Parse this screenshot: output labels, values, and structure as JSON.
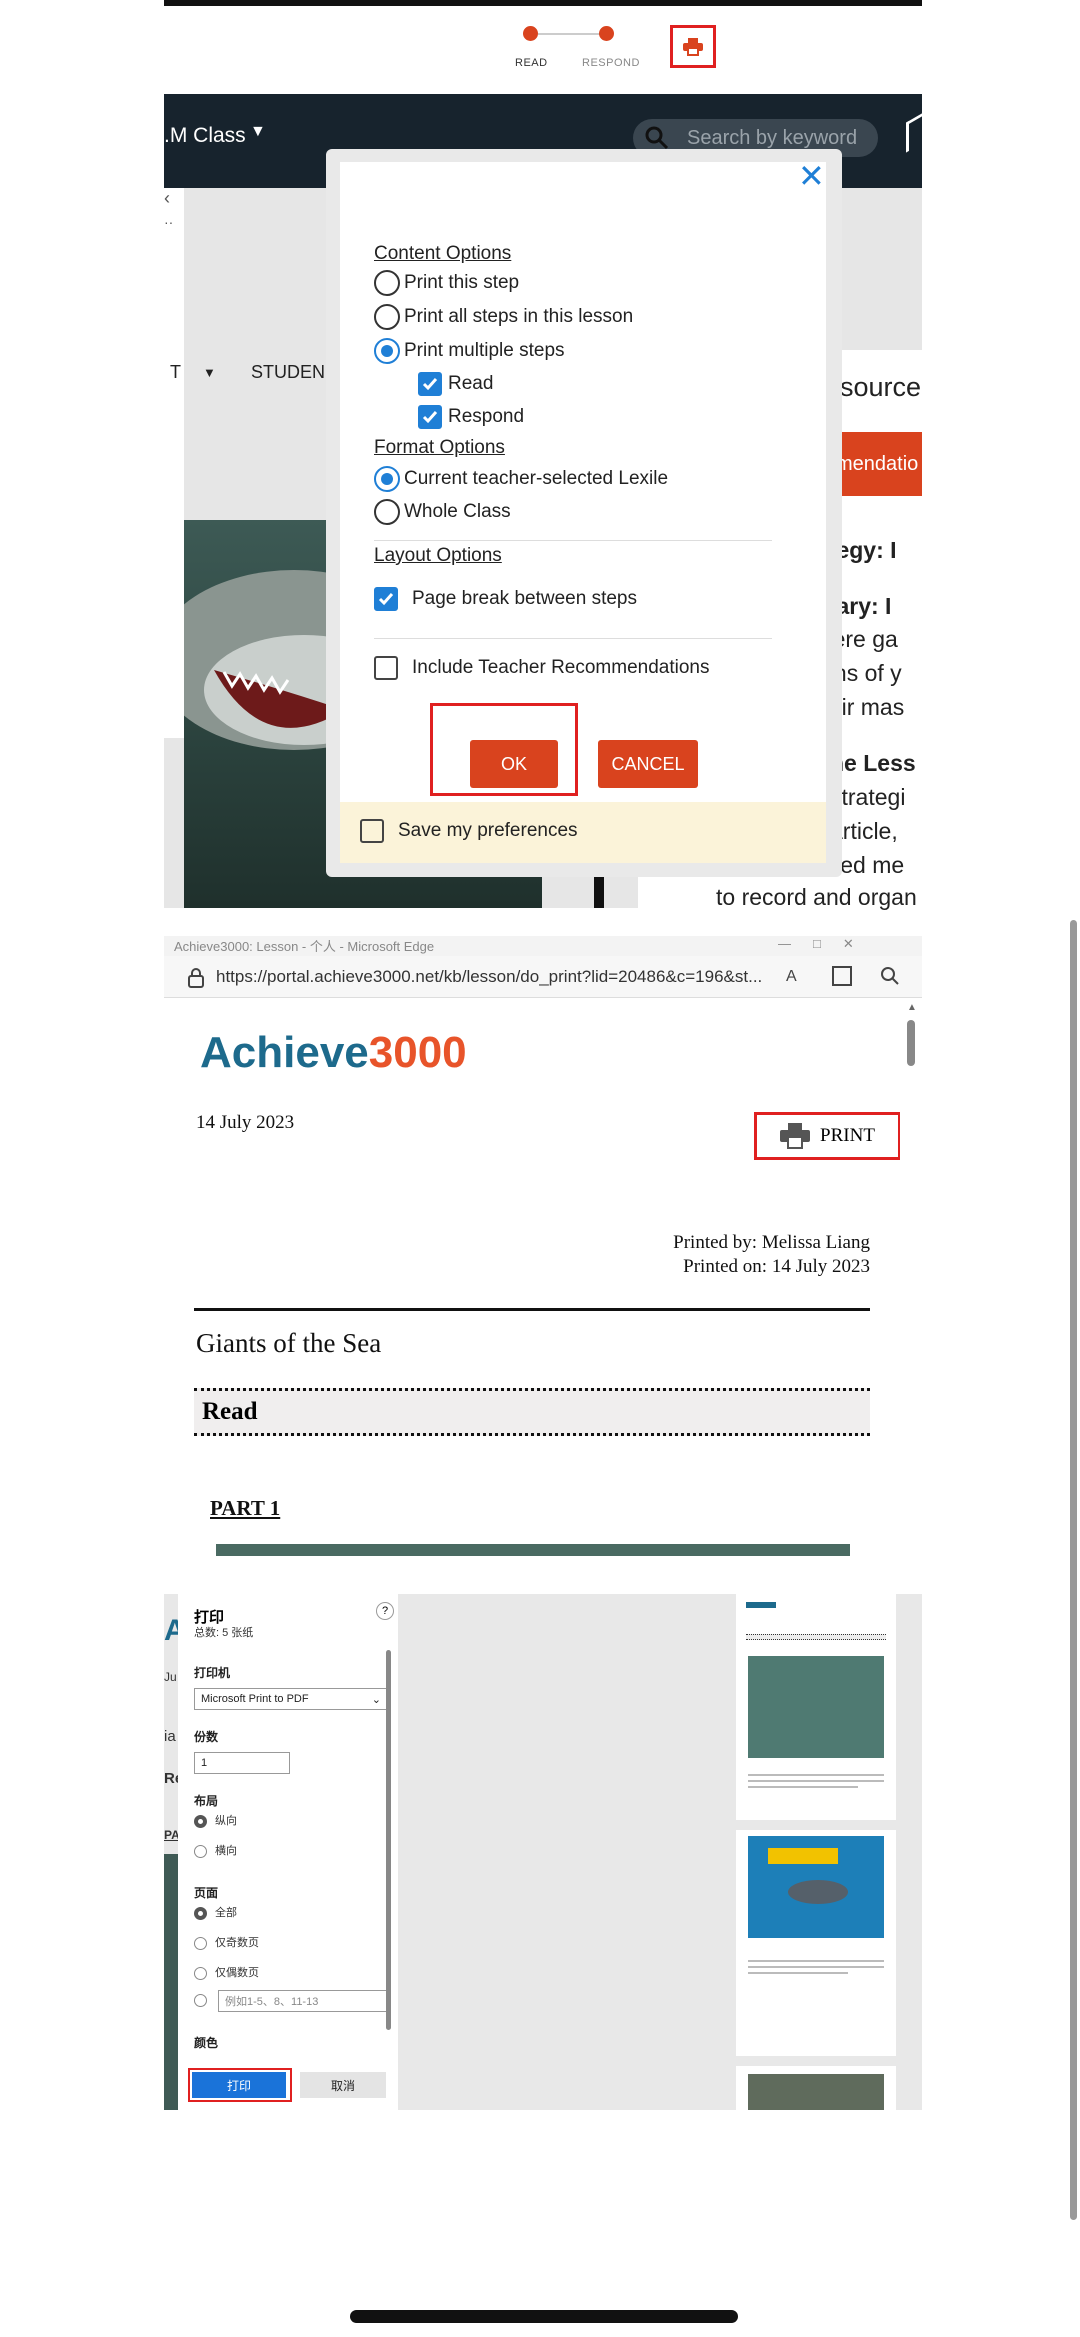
{
  "panel1": {
    "steps": [
      "READ",
      "RESPOND"
    ],
    "class_label": ".M Class",
    "search_placeholder": "Search by keyword",
    "nav_partial": "T",
    "nav_students": "STUDEN",
    "resources_partial": "source",
    "recommendation_partial": "mendatio",
    "right_lines": [
      "ategy: I",
      "mary: I",
      "were ga",
      "ions of y",
      "heir mas",
      "he Less",
      "strategi",
      "article,",
      "lled me",
      "to record and organ"
    ],
    "modal": {
      "content_options_title": "Content Options",
      "content_options": [
        "Print this step",
        "Print all steps in this lesson",
        "Print multiple steps"
      ],
      "content_selected_index": 2,
      "sub_steps": [
        "Read",
        "Respond"
      ],
      "format_options_title": "Format Options",
      "format_options": [
        "Current teacher-selected Lexile",
        "Whole Class"
      ],
      "format_selected_index": 0,
      "layout_options_title": "Layout Options",
      "page_break_label": "Page break between steps",
      "teacher_rec_label": "Include Teacher Recommendations",
      "ok_label": "OK",
      "cancel_label": "CANCEL",
      "save_pref_label": "Save my preferences"
    }
  },
  "panel2": {
    "window_title": "Achieve3000: Lesson - 个人 - Microsoft Edge",
    "url": "https://portal.achieve3000.net/kb/lesson/do_print?lid=20486&c=196&st...",
    "logo_main": "Achieve",
    "logo_num": "3000",
    "date": "14 July 2023",
    "print_label": "PRINT",
    "printed_by": "Printed by: Melissa Liang",
    "printed_on": "Printed on: 14 July 2023",
    "lesson_title": "Giants of the Sea",
    "section": "Read",
    "part": "PART 1"
  },
  "panel3": {
    "title": "打印",
    "subtitle": "总数: 5 张纸",
    "help": "?",
    "printer_label": "打印机",
    "printer_value": "Microsoft Print to PDF",
    "copies_label": "份数",
    "copies_value": "1",
    "layout_label": "布局",
    "layout_options": [
      "纵向",
      "横向"
    ],
    "pages_label": "页面",
    "pages_options": [
      "全部",
      "仅奇数页",
      "仅偶数页"
    ],
    "pages_custom_placeholder": "例如1-5、8、11-13",
    "color_label": "颜色",
    "print_button": "打印",
    "cancel_button": "取消",
    "left_partials": [
      "A",
      "Ju",
      "ia",
      "Re",
      "PA"
    ]
  },
  "colors": {
    "accent": "#d9431e",
    "highlight": "#e02020",
    "blue": "#1f7fd6"
  }
}
